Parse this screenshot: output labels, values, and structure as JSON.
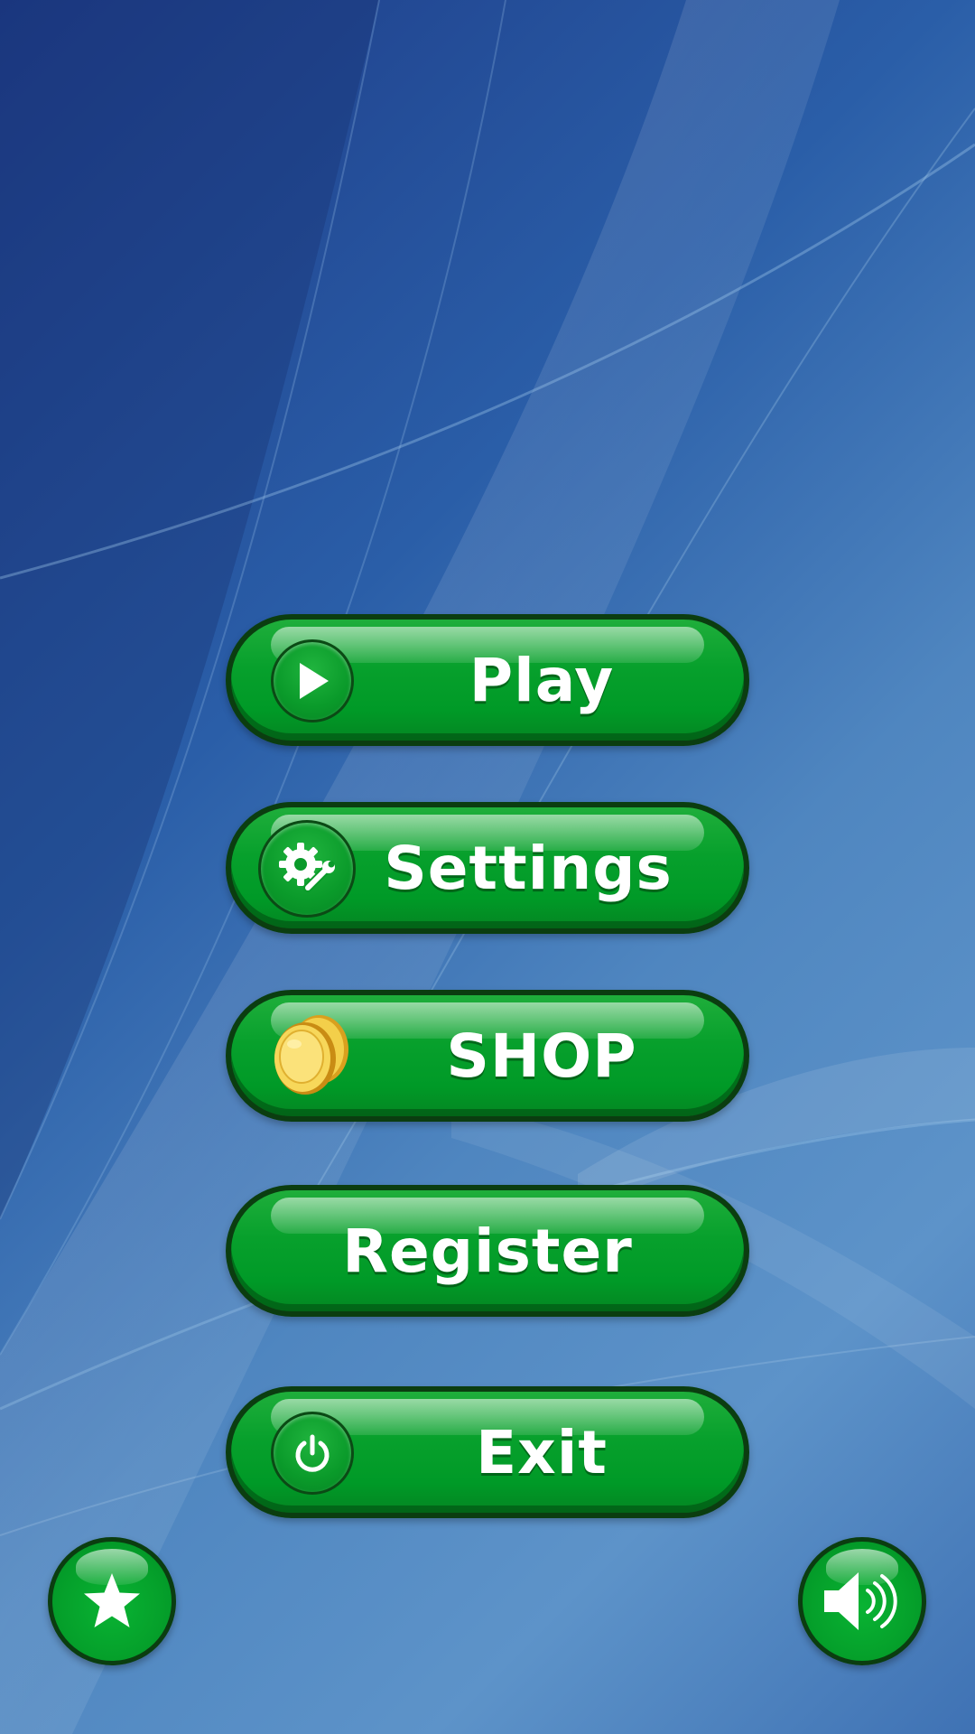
{
  "menu": {
    "play_label": "Play",
    "settings_label": "Settings",
    "shop_label": "SHOP",
    "register_label": "Register",
    "exit_label": "Exit"
  },
  "icons": {
    "play": "play-icon",
    "settings": "gear-wrench-icon",
    "shop": "coins-icon",
    "exit": "power-icon",
    "rate": "star-icon",
    "sound": "speaker-icon"
  },
  "colors": {
    "button_green": "#009a27",
    "button_border": "#0b3d10",
    "label_white": "#ffffff",
    "coin_gold": "#f2c935"
  }
}
